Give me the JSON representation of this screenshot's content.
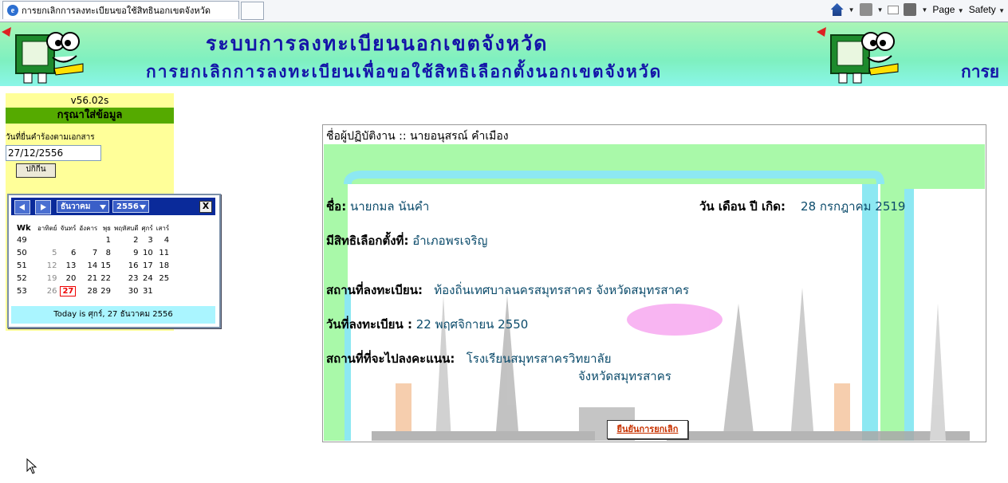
{
  "browser": {
    "tab_title": "การยกเลิกการลงทะเบียนขอใช้สิทธินอกเขตจังหวัด",
    "page_menu": "Page",
    "safety_menu": "Safety"
  },
  "banner": {
    "line1": "ระบบการลงทะเบียนนอกเขตจังหวัด",
    "line2": "การยกเลิกการลงทะเบียนเพื่อขอใช้สิทธิเลือกตั้งนอกเขตจังหวัด",
    "line2_repeat": "การย"
  },
  "sidebar": {
    "version": "v56.02s",
    "header": "กรุณาใส่ข้อมูล",
    "date_label": "วันที่ยื่นคำร้องตามเอกสาร",
    "date_value": "27/12/2556",
    "ok_button": "ปกิกีน"
  },
  "calendar": {
    "month": "ธันวาคม",
    "year": "2556",
    "close": "X",
    "headers": [
      "Wk",
      "อาทิตย์",
      "จันทร์",
      "อังคาร",
      "พุธ",
      "พฤหัสบดี",
      "ศุกร์",
      "เสาร์"
    ],
    "weeks": [
      {
        "wk": "49",
        "days": [
          "",
          "",
          "",
          "",
          "1",
          "2",
          "3",
          "4"
        ]
      },
      {
        "wk": "50",
        "days": [
          "",
          "5",
          "6",
          "7",
          "8",
          "9",
          "10",
          "11"
        ]
      },
      {
        "wk": "51",
        "days": [
          "",
          "12",
          "13",
          "14",
          "15",
          "16",
          "17",
          "18"
        ]
      },
      {
        "wk": "52",
        "days": [
          "",
          "19",
          "20",
          "21",
          "22",
          "23",
          "24",
          "25"
        ]
      },
      {
        "wk": "53",
        "days": [
          "",
          "26",
          "27",
          "28",
          "29",
          "30",
          "31",
          ""
        ]
      }
    ],
    "today_day": "27",
    "footer": "Today is ศุกร์, 27 ธันวาคม 2556"
  },
  "main": {
    "operator": "ชื่อผู้ปฏิบัติงาน :: นายอนุสรณ์ คำเมือง",
    "name_label": "ชื่อ:",
    "name_value": "นายกมล นันคำ",
    "dob_label": "วัน เดือน ปี เกิด:",
    "dob_value": "28 กรกฎาคม 2519",
    "right_label": "มีสิทธิเลือกตั้งที่:",
    "right_value": "อำเภอพรเจริญ",
    "reg_place_label": "สถานที่ลงทะเบียน:",
    "reg_place_value": "ท้องถิ่นเทศบาลนครสมุทรสาคร จังหวัดสมุทรสาคร",
    "reg_date_label": "วันที่ลงทะเบียน :",
    "reg_date_value": "22 พฤศจิกายน 2550",
    "vote_place_label": "สถานที่ที่จะไปลงคะแนน:",
    "vote_place_value": "โรงเรียนสมุทรสาครวิทยาลัย",
    "vote_place_province": "จังหวัดสมุทรสาคร",
    "confirm_button": "ยืนยันการยกเลิก"
  },
  "colors": {
    "banner_text": "#1414a8",
    "sidebar_bg": "#ffff99",
    "sidebar_header": "#55aa00",
    "calendar_header": "#0a2a9a",
    "calendar_footer": "#aaf5ff",
    "value_text": "#0b4b6b",
    "confirm_text": "#c83200"
  }
}
